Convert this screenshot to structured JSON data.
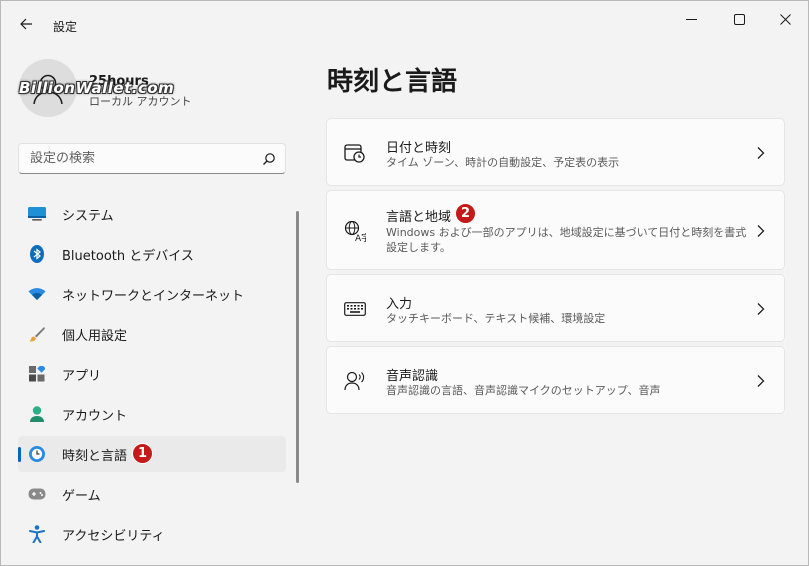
{
  "window": {
    "title": "設定",
    "minimize_glyph": "—",
    "close_glyph": "✕"
  },
  "profile": {
    "name": "25hours",
    "account_type": "ローカル アカウント",
    "watermark": "BillionWallet.com"
  },
  "search": {
    "placeholder": "設定の検索"
  },
  "sidebar": {
    "items": [
      {
        "label": "システム",
        "icon": "system-display-icon"
      },
      {
        "label": "Bluetooth とデバイス",
        "icon": "bluetooth-icon"
      },
      {
        "label": "ネットワークとインターネット",
        "icon": "wifi-icon"
      },
      {
        "label": "個人用設定",
        "icon": "paintbrush-icon"
      },
      {
        "label": "アプリ",
        "icon": "apps-icon"
      },
      {
        "label": "アカウント",
        "icon": "account-icon"
      },
      {
        "label": "時刻と言語",
        "icon": "time-language-icon",
        "selected": true,
        "badge": "1"
      },
      {
        "label": "ゲーム",
        "icon": "gamepad-icon"
      },
      {
        "label": "アクセシビリティ",
        "icon": "accessibility-icon"
      }
    ]
  },
  "main": {
    "title": "時刻と言語",
    "cards": [
      {
        "title": "日付と時刻",
        "description": "タイム ゾーン、時計の自動設定、予定表の表示",
        "icon": "calendar-clock-icon"
      },
      {
        "title": "言語と地域",
        "description_line1": "Windows および一部のアプリは、地域設定に基づいて日付と時刻を書式",
        "description_line2": "設定します。",
        "icon": "language-region-icon",
        "badge": "2"
      },
      {
        "title": "入力",
        "description": "タッチキーボード、テキスト候補、環境設定",
        "icon": "keyboard-icon"
      },
      {
        "title": "音声認識",
        "description": "音声認識の言語、音声認識マイクのセットアップ、音声",
        "icon": "speech-icon"
      }
    ]
  },
  "colors": {
    "accent": "#0067c0",
    "badge": "#c41a1a",
    "background": "#f3f3f3",
    "card": "#fbfbfb"
  }
}
